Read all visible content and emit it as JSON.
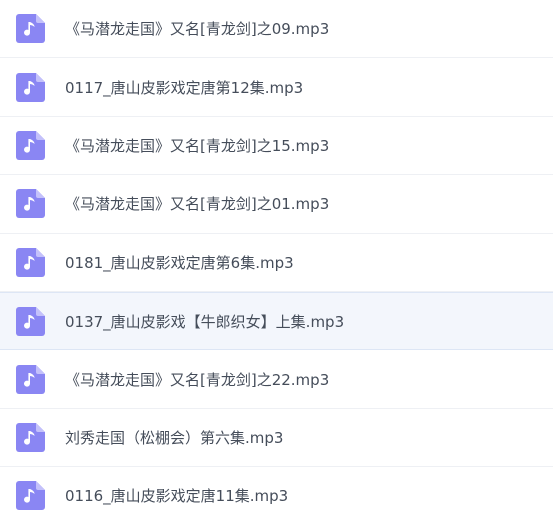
{
  "file_list": {
    "icon": "audio-file-icon",
    "icon_colors": {
      "body": "#8a86f3",
      "fold": "#c4c1fb",
      "note": "#ffffff"
    },
    "hovered_index": 5,
    "items": [
      {
        "name": "《马潜龙走国》又名[青龙剑]之09.mp3"
      },
      {
        "name": "0117_唐山皮影戏定唐第12集.mp3"
      },
      {
        "name": "《马潜龙走国》又名[青龙剑]之15.mp3"
      },
      {
        "name": "《马潜龙走国》又名[青龙剑]之01.mp3"
      },
      {
        "name": "0181_唐山皮影戏定唐第6集.mp3"
      },
      {
        "name": "0137_唐山皮影戏【牛郎织女】上集.mp3"
      },
      {
        "name": "《马潜龙走国》又名[青龙剑]之22.mp3"
      },
      {
        "name": "刘秀走国（松棚会）第六集.mp3"
      },
      {
        "name": "0116_唐山皮影戏定唐11集.mp3"
      }
    ]
  }
}
